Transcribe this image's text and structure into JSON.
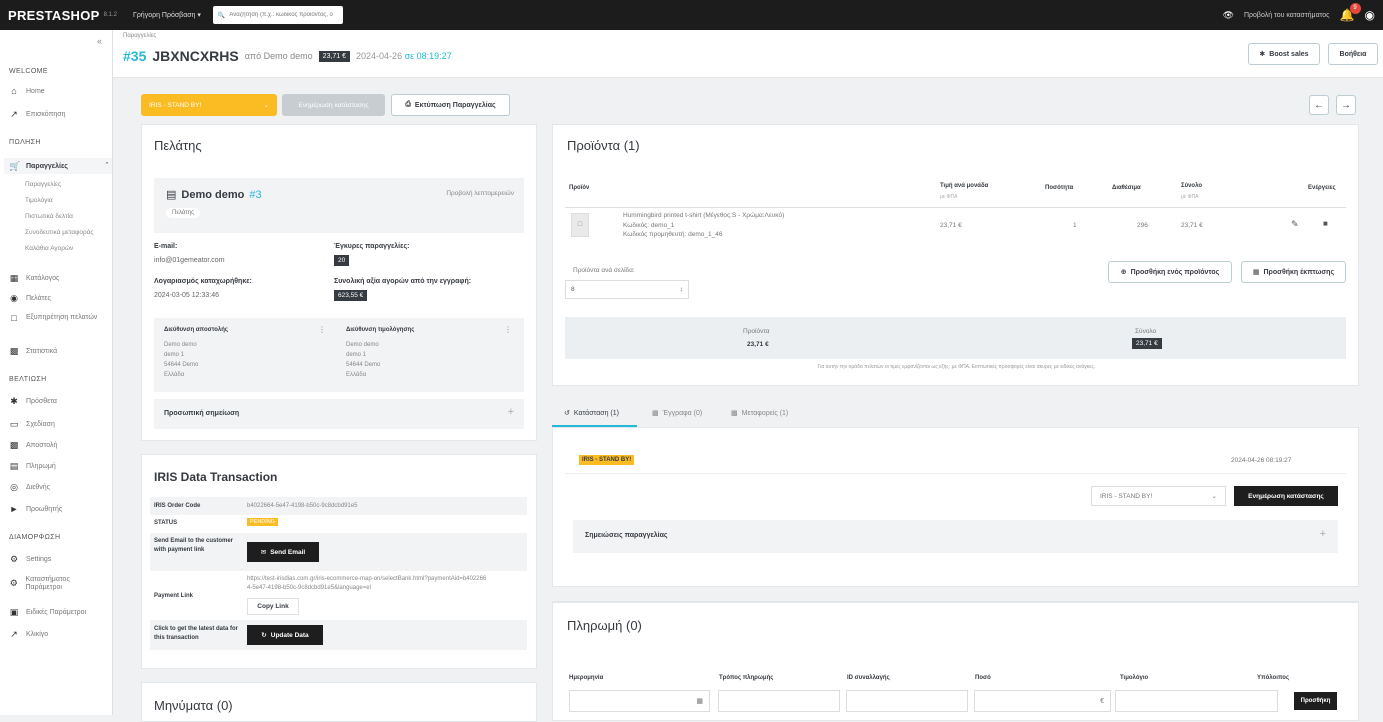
{
  "topbar": {
    "logo": "PRESTASHOP",
    "version": "8.1.2",
    "quick_access": "Γρήγορη Πρόσβαση ▾",
    "search_placeholder": "Αναζήτηση (π.χ.: κωδικός προϊόντος, ό",
    "view_shop": "Προβολή του καταστήματος",
    "notification_count": "9"
  },
  "sidebar": {
    "welcome": "WELCOME",
    "home": "Home",
    "stats": "Επισκόπηση",
    "sales": "ΠΩΛΗΣΗ",
    "orders": "Παραγγελίες",
    "orders_sub": [
      "Παραγγελίες",
      "Τιμολόγια",
      "Πιστωτικά δελτία",
      "Συνοδευτικά μεταφοράς",
      "Καλάθια Αγορών"
    ],
    "catalog": "Κατάλογος",
    "customers": "Πελάτες",
    "service": "Εξυπηρέτηση πελατών",
    "stats2": "Στατιστικά",
    "improve": "ΒΕΛΤΙΩΣΗ",
    "modules": "Πρόσθετα",
    "design": "Σχεδίαση",
    "shipping": "Αποστολή",
    "payment": "Πληρωμή",
    "international": "Διεθνής",
    "addons": "Προωθητής",
    "configure": "ΔΙΑΜΟΡΦΩΣΗ",
    "settings": "Settings",
    "shop_params": "Καταστήματος Παράμετροι",
    "adv_params": "Ειδικές Παράμετροι",
    "more": "Κλικίγο"
  },
  "header": {
    "breadcrumb": "Παραγγελίες",
    "order_num": "#35",
    "order_ref": "JBXNCXRHS",
    "from": "από Demo demo",
    "total": "23,71 €",
    "date": "2024-04-26",
    "time": "σε 08:19:27",
    "boost": "Boost sales",
    "help": "Βοήθεια"
  },
  "actions": {
    "status": "IRIS - STAND BY!",
    "update": "Ενημέρωση κατάστασης",
    "print": "Εκτύπωση Παραγγελίας"
  },
  "customer": {
    "title": "Πελάτης",
    "name": "Demo demo",
    "id": "#3",
    "view": "Προβολή λεπτομερειών",
    "tag": "Πελάτης",
    "email_label": "E-mail:",
    "email": "info@01gemeator.com",
    "valid_orders_label": "Έγκυρες παραγγελίες:",
    "valid_orders": "20",
    "created_label": "Λογαριασμός καταχωρήθηκε:",
    "created": "2024-03-05 12:33:46",
    "total_spent_label": "Συνολική αξία αγορών από την εγγραφή:",
    "total_spent": "623,55 €",
    "ship_label": "Διεύθυνση αποστολής",
    "bill_label": "Διεύθυνση τιμολόγησης",
    "address": [
      "Demo demo",
      "demo 1",
      "54644 Demo",
      "Ελλάδα"
    ],
    "note_label": "Προσωπική σημείωση"
  },
  "iris": {
    "title": "IRIS Data Transaction",
    "code_label": "IRIS Order Code",
    "code": "b4022664-5e47-4198-b50c-9c8dcbd91e5",
    "status_label": "STATUS",
    "status": "PENDING",
    "send_label": "Send Email to the customer with payment link",
    "send_btn": "Send Email",
    "link_label": "Payment Link",
    "link": "https://test-irisdias.com.gr/iris-ecommerce-map-on/selectBank.html?paymentAid=b4022664-5e47-4198-b50c-9c8dcbd91e5&language=el",
    "copy_btn": "Copy Link",
    "update_label": "Click to get the latest data for this transaction",
    "update_btn": "Update Data"
  },
  "messages": {
    "title": "Μηνύματα (0)"
  },
  "products": {
    "title": "Προϊόντα (1)",
    "headers": [
      "Προϊόν",
      "Τιμή ανά μονάδα",
      "Ποσότητα",
      "Διαθέσιμα",
      "Σύνολο",
      "Ενέργειες"
    ],
    "tax_note": "με ΦΠΑ",
    "name": "Hummingbird printed t-shirt (Μέγεθος:S - Χρώμα:Λευκό)",
    "ref": "Κωδικός: demo_1",
    "supref": "Κωδικός προμηθευτή: demo_1_46",
    "price": "23,71 €",
    "qty": "1",
    "stock": "296",
    "total": "23,71 €",
    "per_page_label": "Προϊόντα ανά σελίδα:",
    "per_page": "8",
    "add_product": "Προσθήκη ενός προϊόντος",
    "add_discount": "Προσθήκη έκπτωσης",
    "sum_products_label": "Προϊόντα",
    "sum_products": "23,71 €",
    "sum_total_label": "Σύνολο",
    "sum_total": "23,71 €",
    "footnote": "Για αυτήν την ομάδα πελατών οι τιμές εμφανίζονται ως εξής: με ΦΠΑ. Εκπτωτικές προσφορές είναι άκυρες με ειδικές ανάγκες."
  },
  "tabs": {
    "status": "Κατάσταση (1)",
    "documents": "Έγγραφα (0)",
    "carriers": "Μεταφορείς (1)"
  },
  "history": {
    "status": "IRIS - STAND BY!",
    "date": "2024-04-26 08:19:27",
    "select": "IRIS - STAND BY!",
    "update_btn": "Ενημέρωση κατάστασης",
    "notes": "Σημειώσεις παραγγελίας"
  },
  "payment": {
    "title": "Πληρωμή (0)",
    "headers": [
      "Ημερομηνία",
      "Τρόπος πληρωμής",
      "ID συναλλαγής",
      "Ποσό",
      "Τιμολόγιο",
      "Υπόλοιπος"
    ],
    "currency": "€",
    "add_btn": "Προσθήκη"
  }
}
